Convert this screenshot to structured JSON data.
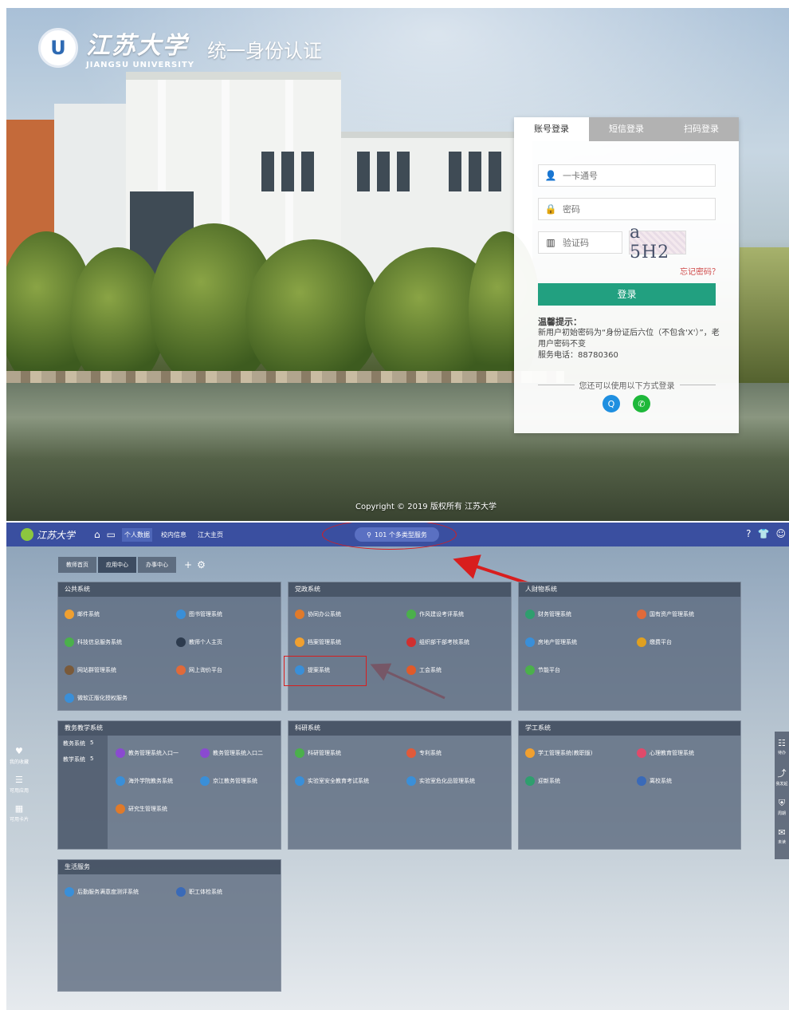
{
  "login": {
    "logo_cn": "江苏大学",
    "logo_en": "JIANGSU UNIVERSITY",
    "system_title": "统一身份认证",
    "tabs": [
      "账号登录",
      "短信登录",
      "扫码登录"
    ],
    "username_placeholder": "一卡通号",
    "password_placeholder": "密码",
    "captcha_placeholder": "验证码",
    "captcha_text": "a 5H2",
    "forgot_link": "忘记密码？",
    "login_button": "登录",
    "tips_title": "温馨提示：",
    "tips_body": "新用户初始密码为“身份证后六位（不包含'X'）”，老用户密码不变",
    "service_phone": "服务电话：88780360",
    "alt_login_text": "您还可以使用以下方式登录",
    "alt_icons": [
      "qq-icon",
      "wechat-icon"
    ],
    "copyright": "Copyright © 2019   版权所有  江苏大学"
  },
  "portal": {
    "logo": "江苏大学",
    "nav": [
      "个人数据",
      "校内信息",
      "江大主页"
    ],
    "search_label": "101 个多类型服务",
    "sub_tabs": [
      "教师首页",
      "应用中心",
      "办事中心"
    ],
    "panels": [
      {
        "title": "公共系统",
        "apps": [
          "邮件系统",
          "图书管理系统",
          "科技信息服务系统",
          "教师个人主页",
          "网站群管理系统",
          "网上询价平台",
          "微软正版化授权服务"
        ]
      },
      {
        "title": "党政系统",
        "apps": [
          "协同办公系统",
          "作风建设考评系统",
          "档案管理系统",
          "组织部干部考核系统",
          "提案系统",
          "工会系统"
        ]
      },
      {
        "title": "人财物系统",
        "apps": [
          "财务管理系统",
          "国有资产管理系统",
          "房地产管理系统",
          "缴费平台",
          "节能平台"
        ]
      },
      {
        "title": "教务教学系统",
        "side": [
          {
            "label": "教务系统",
            "count": "5"
          },
          {
            "label": "教学系统",
            "count": "5"
          }
        ],
        "apps": [
          "教务管理系统入口一",
          "教务管理系统入口二",
          "海外学院教务系统",
          "京江教务管理系统",
          "研究生管理系统"
        ]
      },
      {
        "title": "科研系统",
        "apps": [
          "科研管理系统",
          "专利系统",
          "实验室安全教育考试系统",
          "实验室危化品管理系统"
        ]
      },
      {
        "title": "学工系统",
        "apps": [
          "学工管理系统(教职版)",
          "心理教育管理系统",
          "迎新系统",
          "离校系统"
        ]
      },
      {
        "title": "生活服务",
        "apps": [
          "后勤服务满意度测评系统",
          "职工体检系统"
        ]
      }
    ],
    "left_rail": [
      "我的收藏",
      "可用应用",
      "可用卡片"
    ],
    "right_rail": [
      "待办",
      "我发起",
      "周期",
      "未读"
    ]
  },
  "colors": {
    "login_btn": "#22a080",
    "portal_top": "#3a4fa0",
    "annotation": "#d81e1e"
  }
}
